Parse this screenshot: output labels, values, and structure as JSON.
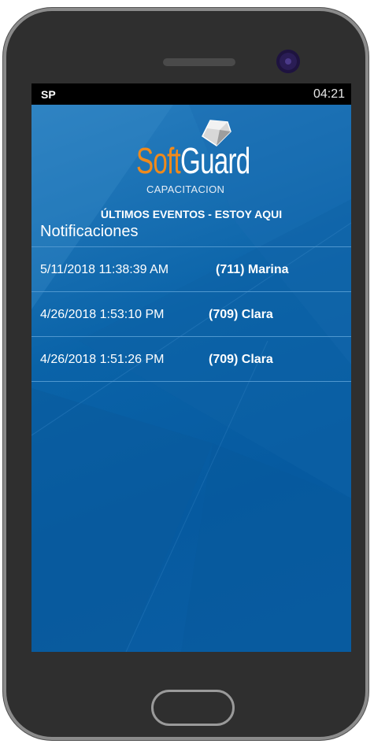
{
  "status_bar": {
    "carrier": "SP",
    "time": "04:21"
  },
  "logo": {
    "soft": "Soft",
    "guard": "Guard",
    "subtitle": "CAPACITACION"
  },
  "header": {
    "title": "ÚLTIMOS EVENTOS - ESTOY AQUI",
    "subtitle": "Notificaciones"
  },
  "events": [
    {
      "datetime": "5/11/2018 11:38:39 AM",
      "name": "(711) Marina"
    },
    {
      "datetime": "4/26/2018 1:53:10 PM",
      "name": "(709) Clara"
    },
    {
      "datetime": "4/26/2018 1:51:26 PM",
      "name": "(709) Clara"
    }
  ],
  "colors": {
    "accent_orange": "#f08a1c",
    "screen_blue": "#0a5ea6"
  }
}
